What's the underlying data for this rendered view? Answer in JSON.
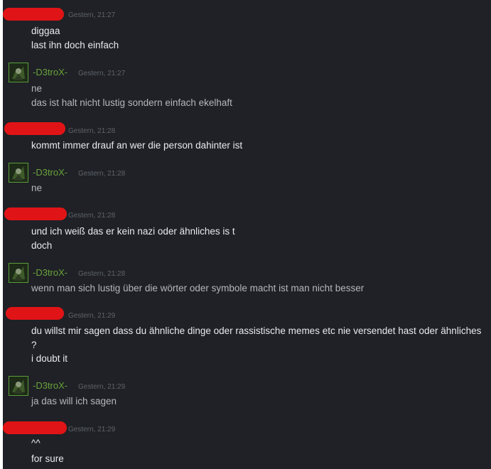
{
  "chat": {
    "messages": [
      {
        "author": "",
        "time": "Gestern, 21:27",
        "lines": [
          "diggaa",
          "last ihn doch einfach"
        ]
      },
      {
        "author": "-D3troX-",
        "time": "Gestern, 21:27",
        "lines": [
          "ne",
          "das ist halt nicht lustig sondern einfach ekelhaft"
        ]
      },
      {
        "author": "",
        "time": "Gestern, 21:28",
        "lines": [
          "kommt immer drauf an wer die person dahinter ist"
        ]
      },
      {
        "author": "-D3troX-",
        "time": "Gestern, 21:28",
        "lines": [
          "ne"
        ]
      },
      {
        "author": "",
        "time": "Gestern, 21:28",
        "lines": [
          "und ich weiß das er kein nazi oder ähnliches is t",
          "doch"
        ]
      },
      {
        "author": "-D3troX-",
        "time": "Gestern, 21:28",
        "lines": [
          "wenn man sich lustig über die wörter oder symbole macht ist man nicht besser"
        ]
      },
      {
        "author": "",
        "time": "Gestern, 21:29",
        "lines": [
          "du willst mir sagen dass du ähnliche dinge oder rassistische memes etc nie versendet hast oder ähnliches ?",
          "i doubt it"
        ]
      },
      {
        "author": "-D3troX-",
        "time": "Gestern, 21:29",
        "lines": [
          "ja das will ich sagen"
        ]
      },
      {
        "author": "",
        "time": "Gestern, 21:29",
        "lines": [
          "^^",
          "for sure"
        ]
      }
    ],
    "colors": {
      "background": "#1f2126",
      "self_name": "#6aa33a",
      "redaction": "#e01416",
      "timestamp": "#5e636b"
    }
  }
}
